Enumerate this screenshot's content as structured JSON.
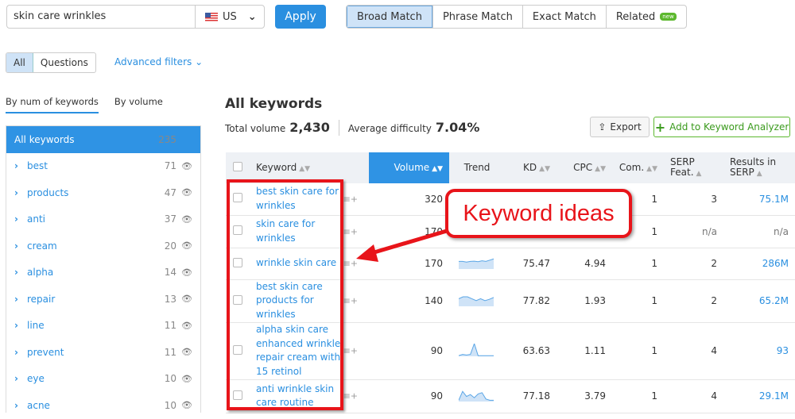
{
  "search": {
    "query": "skin care wrinkles",
    "country": "US",
    "apply": "Apply"
  },
  "match_tabs": [
    "Broad Match",
    "Phrase Match",
    "Exact Match",
    "Related"
  ],
  "new_badge": "new",
  "filter_seg": [
    "All",
    "Questions"
  ],
  "advanced_filters": "Advanced filters",
  "side_tabs": [
    "By num of keywords",
    "By volume"
  ],
  "sidebar": [
    {
      "label": "All keywords",
      "count": "235"
    },
    {
      "label": "best",
      "count": "71"
    },
    {
      "label": "products",
      "count": "47"
    },
    {
      "label": "anti",
      "count": "37"
    },
    {
      "label": "cream",
      "count": "20"
    },
    {
      "label": "alpha",
      "count": "14"
    },
    {
      "label": "repair",
      "count": "13"
    },
    {
      "label": "line",
      "count": "11"
    },
    {
      "label": "prevent",
      "count": "11"
    },
    {
      "label": "eye",
      "count": "10"
    },
    {
      "label": "acne",
      "count": "10"
    }
  ],
  "main": {
    "title": "All keywords",
    "total_label": "Total volume",
    "total": "2,430",
    "diff_label": "Average difficulty",
    "diff": "7.04%",
    "export": "Export",
    "add": "Add to Keyword Analyzer"
  },
  "columns": [
    "Keyword",
    "Volume",
    "Trend",
    "KD",
    "CPC",
    "Com.",
    "SERP Feat.",
    "Results in SERP"
  ],
  "rows": [
    {
      "kw": "best skin care for wrinkles",
      "vol": "320",
      "kd": "",
      "cpc": "",
      "com": "1",
      "serp": "3",
      "res": "75.1M",
      "trend": []
    },
    {
      "kw": "skin care for wrinkles",
      "vol": "170",
      "kd": "",
      "cpc": "",
      "com": "1",
      "serp": "n/a",
      "res": "n/a",
      "trend": []
    },
    {
      "kw": "wrinkle skin care",
      "vol": "170",
      "kd": "75.47",
      "cpc": "4.94",
      "com": "1",
      "serp": "2",
      "res": "286M",
      "trend": [
        0.6,
        0.6,
        0.55,
        0.6,
        0.62,
        0.58,
        0.65,
        0.6,
        0.7,
        0.8
      ]
    },
    {
      "kw": "best skin care products for wrinkles",
      "vol": "140",
      "kd": "77.82",
      "cpc": "1.93",
      "com": "1",
      "serp": "2",
      "res": "65.2M",
      "trend": [
        0.6,
        0.75,
        0.75,
        0.6,
        0.45,
        0.6,
        0.45,
        0.55,
        0.7
      ]
    },
    {
      "kw": "alpha skin care enhanced wrinkle repair cream with 15 retinol",
      "vol": "90",
      "kd": "63.63",
      "cpc": "1.11",
      "com": "1",
      "serp": "4",
      "res": "93",
      "trend": [
        0.05,
        0.15,
        0.1,
        0.15,
        1,
        0.05,
        0.05,
        0.05,
        0.05,
        0.05
      ]
    },
    {
      "kw": "anti wrinkle skin care routine",
      "vol": "90",
      "kd": "77.18",
      "cpc": "3.79",
      "com": "1",
      "serp": "4",
      "res": "29.1M",
      "trend": [
        0.1,
        0.8,
        0.4,
        0.55,
        0.3,
        0.6,
        0.7,
        0.2,
        0.1,
        0.1
      ]
    }
  ],
  "callout": "Keyword ideas",
  "colors": {
    "accent": "#2f93e4",
    "annotation": "#e8141a",
    "green": "#5cb82e"
  }
}
